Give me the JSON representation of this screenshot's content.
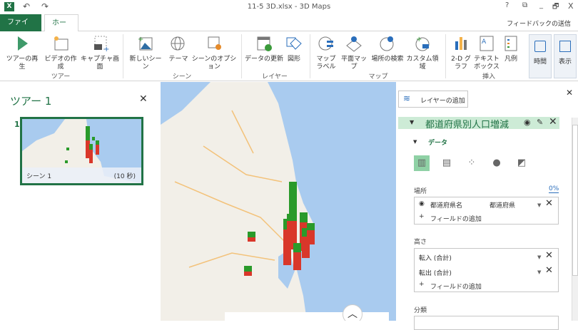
{
  "window": {
    "title": "11-5 3D.xlsx - 3D Maps",
    "help": "?",
    "restore": "⧉",
    "minimize": "_",
    "maximize": "🗗",
    "close": "X"
  },
  "tabs": {
    "file": "ファイル",
    "home": "ホーム",
    "feedback": "フィードバックの送信"
  },
  "ribbon": {
    "play_tour": "ツアーの再生",
    "create_video": "ビデオの作成",
    "capture": "キャプチャ画面",
    "group_tour": "ツアー",
    "new_scene": "新しいシーン",
    "theme": "テーマ",
    "scene_options": "シーンのオプション",
    "group_scene": "シーン",
    "refresh": "データの更新",
    "shapes": "図形",
    "group_layer": "レイヤー",
    "map_labels": "マップ ラベル",
    "flat_map": "平面マップ",
    "find_location": "場所の検索",
    "custom_regions": "カスタム領域",
    "group_map": "マップ",
    "chart_2d": "2-D グラフ",
    "text_box": "テキスト ボックス",
    "legend": "凡例",
    "group_insert": "挿入",
    "time": "時間",
    "view": "表示"
  },
  "tour": {
    "title": "ツアー 1",
    "scene_number": "1",
    "scene_name": "シーン 1",
    "scene_duration": "(10 秒)"
  },
  "layer_pane": {
    "add_layer": "レイヤーの追加",
    "layer_name": "都道府県別人口増減",
    "data_section": "データ",
    "location_label": "場所",
    "location_percent": "0%",
    "location_field": "都道府県名",
    "location_type": "都道府県",
    "add_field": "フィールドの追加",
    "height_label": "高さ",
    "height_fields": [
      "転入 (合計)",
      "転出 (合計)"
    ],
    "category_label": "分類"
  },
  "colors": {
    "accent": "#217346",
    "bar_top": "#2a9a2a",
    "bar_bottom": "#d9372a",
    "sea": "#a9cbef",
    "land": "#f2efe8"
  }
}
